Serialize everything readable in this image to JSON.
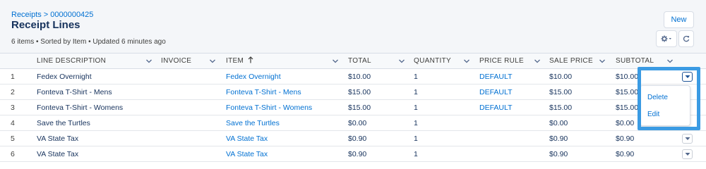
{
  "header": {
    "breadcrumb": {
      "parent": "Receipts",
      "separator": ">",
      "current": "0000000425"
    },
    "title": "Receipt Lines",
    "meta": "6 items • Sorted by Item • Updated 6 minutes ago",
    "new_label": "New",
    "settings_icon": "gear-icon",
    "refresh_icon": "refresh-icon"
  },
  "columns": [
    {
      "key": "num",
      "label": ""
    },
    {
      "key": "line_description",
      "label": "LINE DESCRIPTION"
    },
    {
      "key": "invoice",
      "label": "INVOICE"
    },
    {
      "key": "item",
      "label": "ITEM",
      "sort_icon": "arrow-up-icon"
    },
    {
      "key": "total",
      "label": "TOTAL"
    },
    {
      "key": "quantity",
      "label": "QUANTITY"
    },
    {
      "key": "price_rule",
      "label": "PRICE RULE"
    },
    {
      "key": "sale_price",
      "label": "SALE PRICE"
    },
    {
      "key": "subtotal",
      "label": "SUBTOTAL"
    }
  ],
  "rows": [
    {
      "num": "1",
      "line_description": "Fedex Overnight",
      "invoice": "",
      "item": "Fedex Overnight",
      "total": "$10.00",
      "quantity": "1",
      "price_rule": "DEFAULT",
      "sale_price": "$10.00",
      "subtotal": "$10.00"
    },
    {
      "num": "2",
      "line_description": "Fonteva T-Shirt - Mens",
      "invoice": "",
      "item": "Fonteva T-Shirt - Mens",
      "total": "$15.00",
      "quantity": "1",
      "price_rule": "DEFAULT",
      "sale_price": "$15.00",
      "subtotal": "$15.00"
    },
    {
      "num": "3",
      "line_description": "Fonteva T-Shirt - Womens",
      "invoice": "",
      "item": "Fonteva T-Shirt - Womens",
      "total": "$15.00",
      "quantity": "1",
      "price_rule": "DEFAULT",
      "sale_price": "$15.00",
      "subtotal": "$15.00"
    },
    {
      "num": "4",
      "line_description": "Save the Turtles",
      "invoice": "",
      "item": "Save the Turtles",
      "total": "$0.00",
      "quantity": "1",
      "price_rule": "",
      "sale_price": "$0.00",
      "subtotal": "$0.00"
    },
    {
      "num": "5",
      "line_description": "VA State Tax",
      "invoice": "",
      "item": "VA State Tax",
      "total": "$0.90",
      "quantity": "1",
      "price_rule": "",
      "sale_price": "$0.90",
      "subtotal": "$0.90"
    },
    {
      "num": "6",
      "line_description": "VA State Tax",
      "invoice": "",
      "item": "VA State Tax",
      "total": "$0.90",
      "quantity": "1",
      "price_rule": "",
      "sale_price": "$0.90",
      "subtotal": "$0.90"
    }
  ],
  "row_menu": {
    "open_row": "1",
    "items": [
      {
        "label": "Delete"
      },
      {
        "label": "Edit"
      }
    ]
  },
  "colors": {
    "link": "#0070d2",
    "header_bg": "#f4f6f9",
    "highlight": "#3b9be3"
  }
}
